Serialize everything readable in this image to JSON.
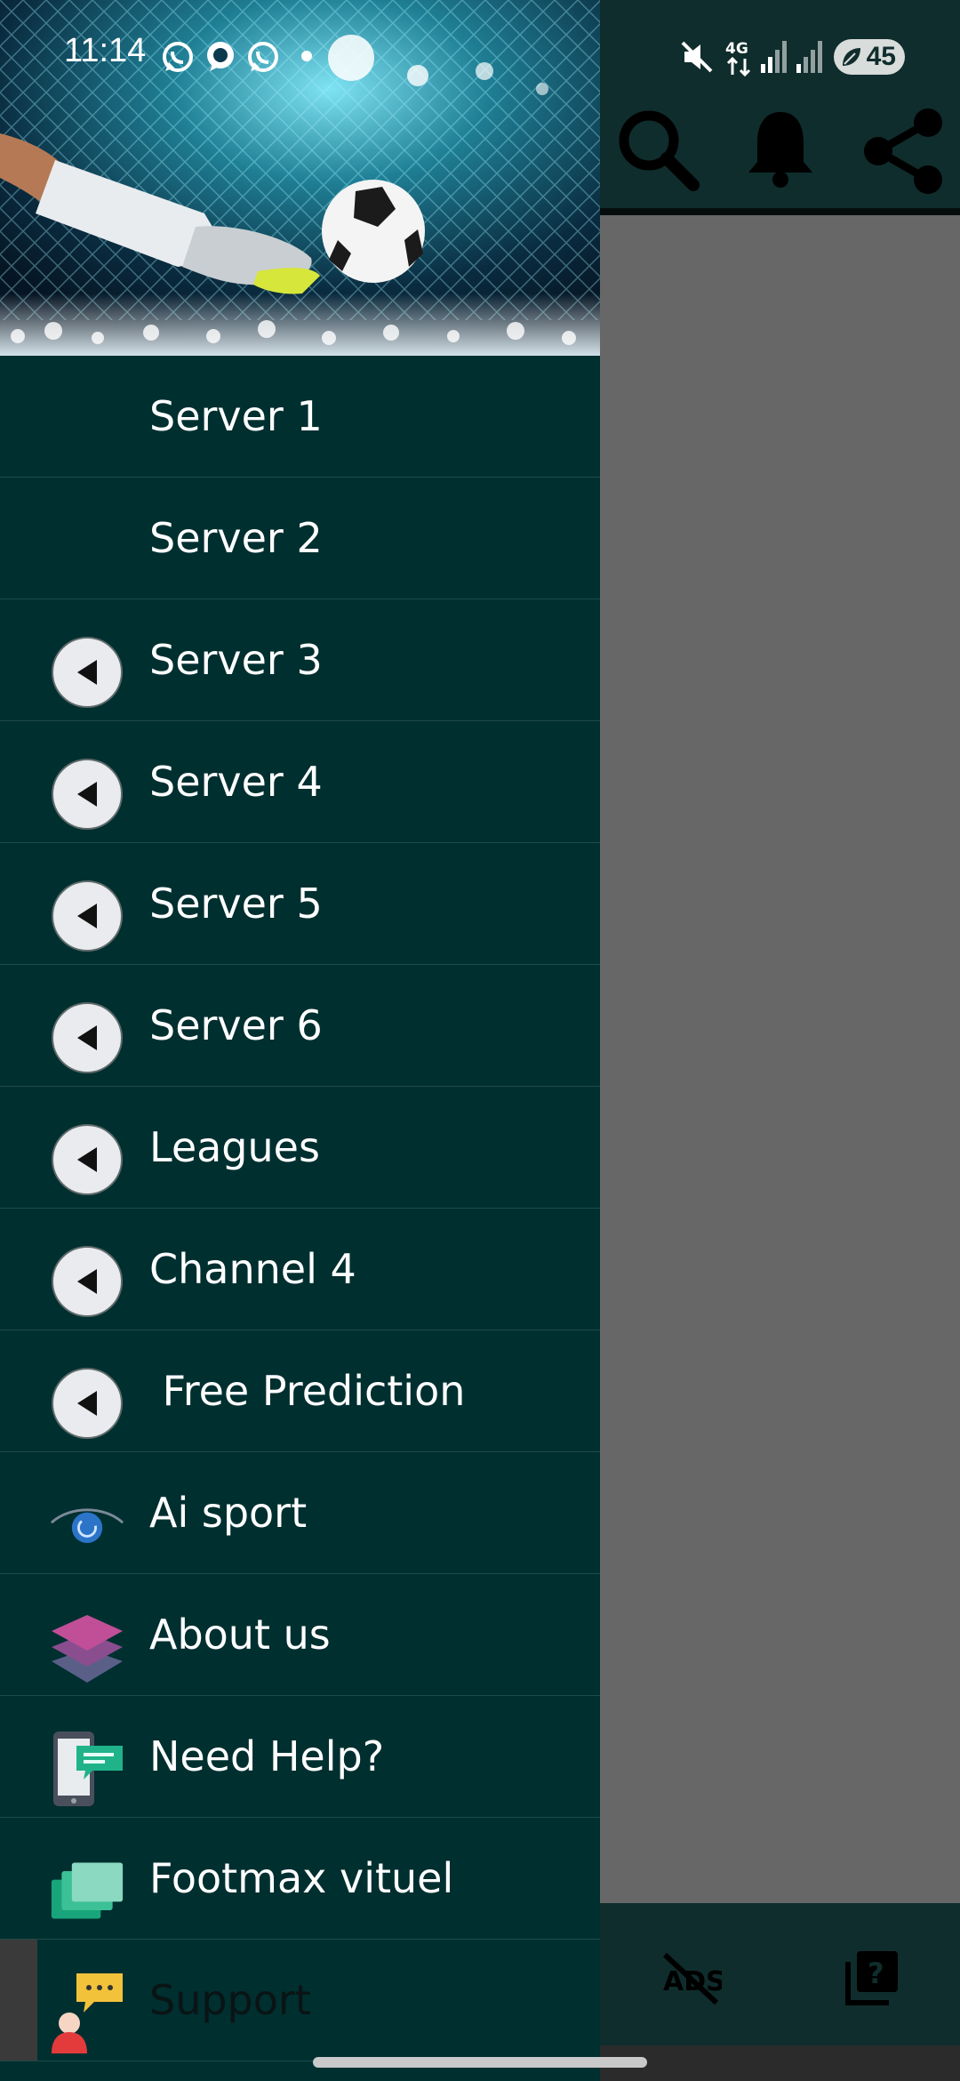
{
  "status_bar": {
    "time": "11:14",
    "battery": "45",
    "network": "4G"
  },
  "drawer": {
    "items": [
      {
        "label": "Server 1",
        "icon": "none"
      },
      {
        "label": "Server 2",
        "icon": "none"
      },
      {
        "label": "Server 3",
        "icon": "play-back-icon"
      },
      {
        "label": "Server 4",
        "icon": "play-back-icon"
      },
      {
        "label": "Server 5",
        "icon": "play-back-icon"
      },
      {
        "label": "Server 6",
        "icon": "play-back-icon"
      },
      {
        "label": "Leagues",
        "icon": "play-back-icon"
      },
      {
        "label": "Channel 4",
        "icon": "play-back-icon"
      },
      {
        "label": " Free Prediction",
        "icon": "play-back-icon"
      },
      {
        "label": "Ai sport",
        "icon": "eye-icon"
      },
      {
        "label": "About us",
        "icon": "layers-icon"
      },
      {
        "label": "Need Help?",
        "icon": "phone-chat-icon"
      },
      {
        "label": "Footmax vituel",
        "icon": "stacked-cards-icon"
      },
      {
        "label": "Support",
        "icon": "support-chat-icon"
      }
    ]
  },
  "colors": {
    "drawer_bg": "#002f30",
    "toolbar_bg": "#0f2d2c",
    "scrim": "#676767",
    "text": "#ffffff"
  }
}
